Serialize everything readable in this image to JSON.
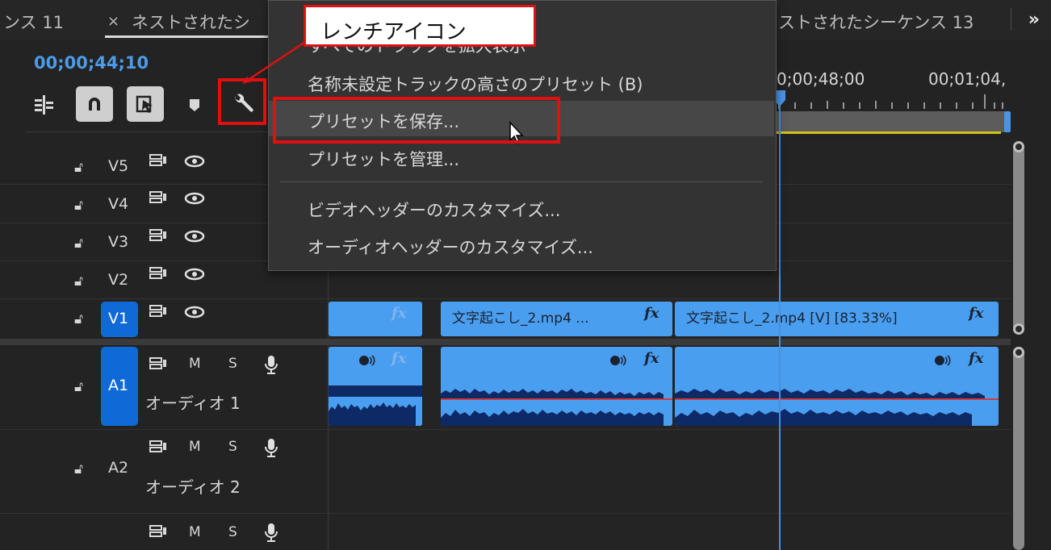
{
  "tabs": {
    "tab1_label": "ンス 11",
    "tab2_close": "×",
    "tab2_label": "ネストされたシ",
    "tab3_label": "ストされたシーケンス 13",
    "more": "»"
  },
  "header": {
    "timecode": "00;00;44;10"
  },
  "ruler": {
    "tc1": "0;00;48;00",
    "tc2": "00;01;04,"
  },
  "menu": {
    "items": [
      "すべてのトラックを拡大表示",
      "名称未設定トラックの高さのプリセット (B)",
      "プリセットを保存...",
      "プリセットを管理...",
      "ビデオヘッダーのカスタマイズ...",
      "オーディオヘッダーのカスタマイズ..."
    ]
  },
  "tracks": {
    "video": [
      "V5",
      "V4",
      "V3",
      "V2",
      "V1"
    ],
    "audio": [
      "A1",
      "A2"
    ],
    "audio_names": [
      "オーディオ 1",
      "オーディオ 2"
    ],
    "m_label": "M",
    "s_label": "S"
  },
  "clips": {
    "clip2_title": "文字起こし_2.mp4 ...",
    "clip3_title": "文字起こし_2.mp4 [V] [83.33%]",
    "fx": "fx"
  },
  "annotation": {
    "callout_text": "レンチアイコン"
  },
  "colors": {
    "accent_blue": "#0f6ad8",
    "clip_blue": "#4a9ef0",
    "timecode_blue": "#4c9be8",
    "annotation_red": "#e01010"
  }
}
